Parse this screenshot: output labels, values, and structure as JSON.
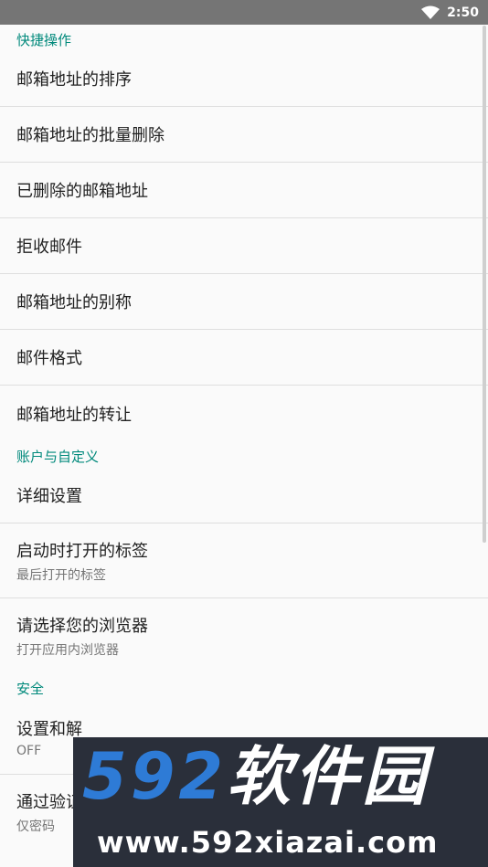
{
  "status_bar": {
    "time": "2:50",
    "wifi_icon": "wifi-icon"
  },
  "sections": {
    "quick_actions": {
      "header": "快捷操作",
      "items": [
        {
          "title": "邮箱地址的排序"
        },
        {
          "title": "邮箱地址的批量删除"
        },
        {
          "title": "已删除的邮箱地址"
        },
        {
          "title": "拒收邮件"
        },
        {
          "title": "邮箱地址的别称"
        },
        {
          "title": "邮件格式"
        },
        {
          "title": "邮箱地址的转让"
        }
      ]
    },
    "account_custom": {
      "header": "账户与自定义",
      "items": [
        {
          "title": "详细设置"
        },
        {
          "title": "启动时打开的标签",
          "summary": "最后打开的标签"
        },
        {
          "title": "请选择您的浏览器",
          "summary": "打开应用内浏览器"
        }
      ]
    },
    "security": {
      "header": "安全",
      "items": [
        {
          "title": "设置和解",
          "summary": "OFF"
        },
        {
          "title": "通过验证",
          "summary": "仅密码"
        }
      ]
    }
  },
  "watermark": {
    "logo_digits": "592",
    "logo_text": "软件园",
    "url": "www.592xiazai.com"
  },
  "colors": {
    "accent": "#00897b",
    "statusbar": "#757575",
    "background": "#fafafa"
  }
}
